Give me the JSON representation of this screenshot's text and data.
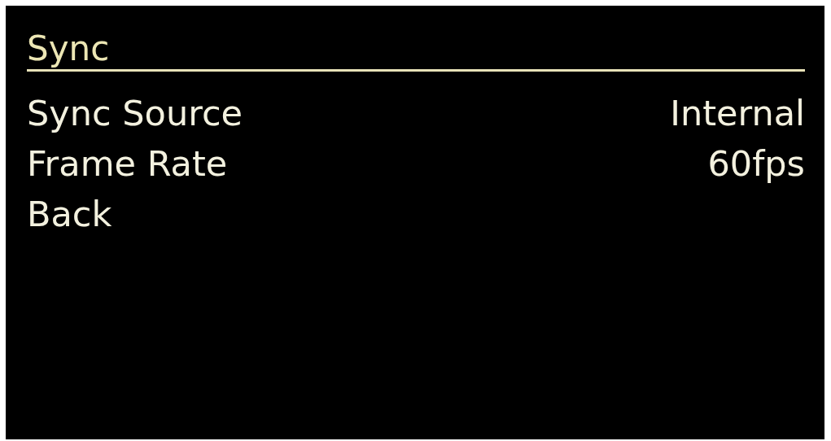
{
  "menu": {
    "title": "Sync",
    "items": [
      {
        "label": "Sync Source",
        "value": "Internal"
      },
      {
        "label": "Frame Rate",
        "value": "60fps"
      },
      {
        "label": "Back"
      }
    ]
  }
}
